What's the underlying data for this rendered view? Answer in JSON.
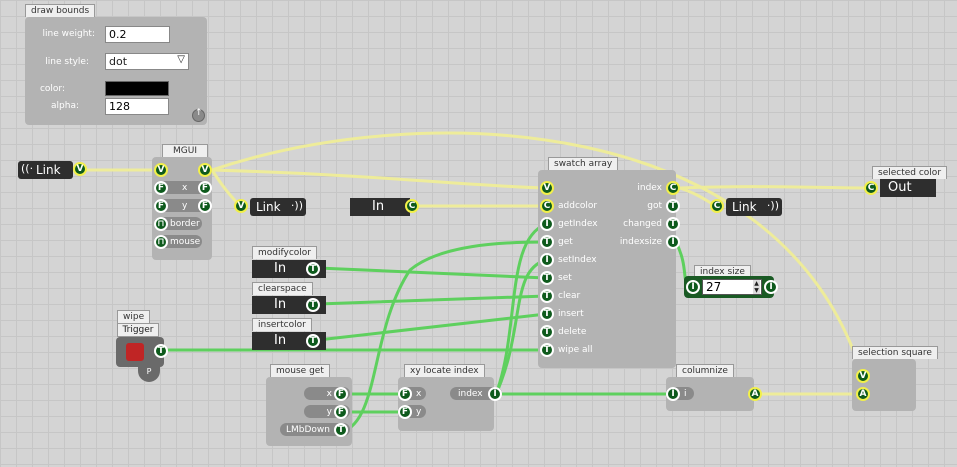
{
  "draw_bounds": {
    "title": "draw bounds",
    "line_weight_label": "line weight:",
    "line_weight": "0.2",
    "line_style_label": "line style:",
    "line_style": "dot",
    "color_label": "color:",
    "color": "#000000",
    "alpha_label": "alpha:",
    "alpha": "128"
  },
  "link_in": {
    "label": "Link"
  },
  "mgui": {
    "title": "MGUI",
    "x": "x",
    "y": "y",
    "border": "border",
    "mouse": "mouse"
  },
  "link_mid": {
    "label": "Link"
  },
  "in_c": {
    "label": "In"
  },
  "swatch": {
    "title": "swatch array",
    "addcolor": "addcolor",
    "getIndex": "getIndex",
    "get": "get",
    "setIndex": "setIndex",
    "set": "set",
    "clear": "clear",
    "insert": "insert",
    "delete": "delete",
    "wipe_all": "wipe all",
    "index": "index",
    "got": "got",
    "changed": "changed",
    "indexsize": "indexsize"
  },
  "link_swatch": {
    "label": "Link"
  },
  "selected_color": {
    "title": "selected color",
    "label": "Out"
  },
  "modifycolor": {
    "title": "modifycolor",
    "label": "In"
  },
  "clearspace": {
    "title": "clearspace",
    "label": "In"
  },
  "insertcolor": {
    "title": "insertcolor",
    "label": "In"
  },
  "index_size": {
    "title": "index size",
    "value": "27"
  },
  "wipe": {
    "title": "wipe",
    "trigger": "Trigger",
    "p": "P"
  },
  "mouse_get": {
    "title": "mouse get",
    "x": "x",
    "y": "y",
    "lmb": "LMbDown"
  },
  "xy_locate": {
    "title": "xy locate index",
    "x": "x",
    "y": "y",
    "index": "index"
  },
  "columnize": {
    "title": "columnize",
    "i": "i"
  },
  "selection_square": {
    "title": "selection square"
  },
  "pin_types": {
    "value": "V",
    "float": "F",
    "int": "I",
    "color": "C",
    "array": "A",
    "trigger": "T"
  },
  "colors": {
    "wire_green": "#5ed05e",
    "wire_yellow": "#eeec9a",
    "pin_fill": "#0d5a1c",
    "trigger_red": "#c02525"
  }
}
